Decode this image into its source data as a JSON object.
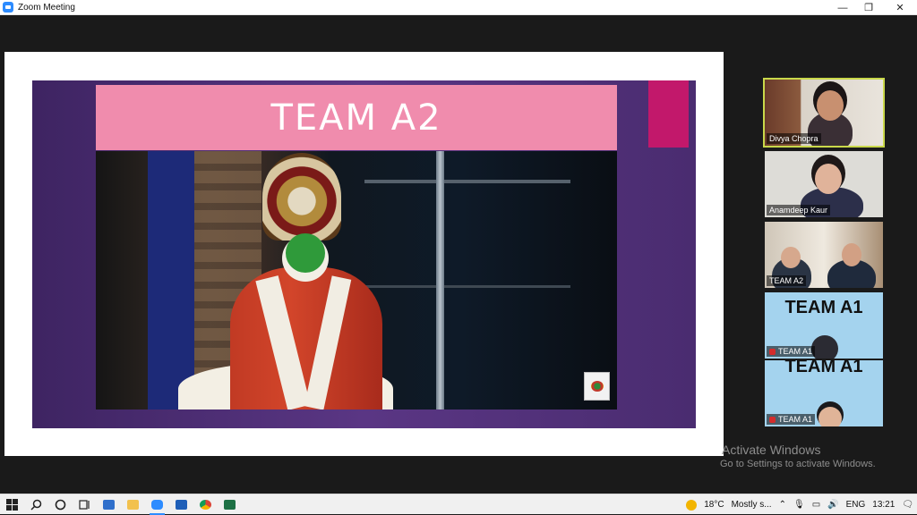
{
  "window": {
    "title": "Zoom Meeting",
    "minimize_glyph": "—",
    "maximize_glyph": "❐",
    "close_glyph": "✕"
  },
  "slide": {
    "title": "TEAM A2"
  },
  "participants": [
    {
      "name": "Divya Chopra",
      "active_speaker": true
    },
    {
      "name": "Anamdeep Kaur",
      "active_speaker": false
    },
    {
      "name": "TEAM A2",
      "active_speaker": false
    },
    {
      "name": "TEAM A1",
      "video_label": "TEAM A1",
      "muted": true
    },
    {
      "name": "TEAM A1",
      "video_label": "TEAM A1",
      "muted": true
    }
  ],
  "watermark": {
    "title": "Activate Windows",
    "subtitle": "Go to Settings to activate Windows."
  },
  "taskbar": {
    "icons": [
      "windows-start-icon",
      "search-icon",
      "cortana-icon",
      "task-view-icon",
      "store-icon",
      "file-explorer-icon",
      "zoom-icon",
      "photos-icon",
      "chrome-icon",
      "excel-icon"
    ],
    "weather": "18°C",
    "weather_desc": "Mostly s...",
    "language": "ENG",
    "time": "13:21"
  }
}
